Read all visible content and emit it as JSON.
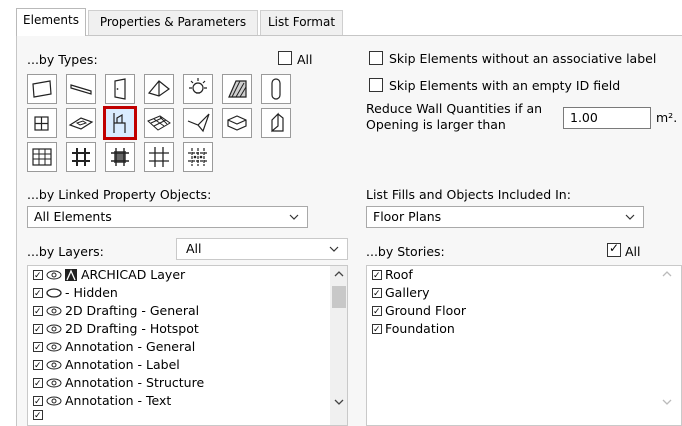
{
  "tabs": [
    {
      "label": "Elements"
    },
    {
      "label": "Properties & Parameters"
    },
    {
      "label": "List Format"
    }
  ],
  "by_types": {
    "label": "...by Types:",
    "all_label": "All",
    "all_checked": false,
    "type_icons": [
      "slab-icon",
      "beam-icon",
      "door-icon",
      "roof-icon",
      "lamp-icon",
      "fill-hatch-icon",
      "column-icon",
      "window-icon",
      "skylight-icon",
      "object-chair-icon",
      "mesh-icon",
      "shell-icon",
      "morph-icon",
      "curtain-wall-panel-icon",
      "curtain-wall-icon",
      "frame-icon",
      "panel-icon",
      "grid-icon",
      "accessory-icon"
    ],
    "selected_icon": "object-chair-icon"
  },
  "options": {
    "skip_assoc_label": "Skip Elements without an associative label",
    "skip_empty_id": "Skip Elements with an empty ID field",
    "reduce_wall_label_1": "Reduce Wall Quantities if an",
    "reduce_wall_label_2": "Opening is larger than",
    "reduce_wall_value": "1.00",
    "reduce_wall_unit": "m²."
  },
  "linked_props": {
    "label": "...by Linked Property Objects:",
    "value": "All Elements"
  },
  "list_fills": {
    "label": "List Fills and Objects Included In:",
    "value": "Floor Plans"
  },
  "layers": {
    "label": "...by Layers:",
    "filter_value": "All",
    "items": [
      {
        "label": "ARCHICAD Layer",
        "icon": "archicad-layer-icon"
      },
      {
        "label": "- Hidden",
        "icon": "hidden-eye-icon"
      },
      {
        "label": "2D Drafting - General",
        "icon": "eye-icon"
      },
      {
        "label": "2D Drafting - Hotspot",
        "icon": "eye-icon"
      },
      {
        "label": "Annotation - General",
        "icon": "eye-icon"
      },
      {
        "label": "Annotation - Label",
        "icon": "eye-icon"
      },
      {
        "label": "Annotation - Structure",
        "icon": "eye-icon"
      },
      {
        "label": "Annotation - Text",
        "icon": "eye-icon"
      }
    ]
  },
  "stories": {
    "label": "...by Stories:",
    "all_label": "All",
    "all_checked": true,
    "items": [
      {
        "label": "Roof"
      },
      {
        "label": "Gallery"
      },
      {
        "label": "Ground Floor"
      },
      {
        "label": "Foundation"
      }
    ]
  },
  "colors": {
    "selection_border": "#c00000",
    "selection_fill": "#d9ecff"
  }
}
